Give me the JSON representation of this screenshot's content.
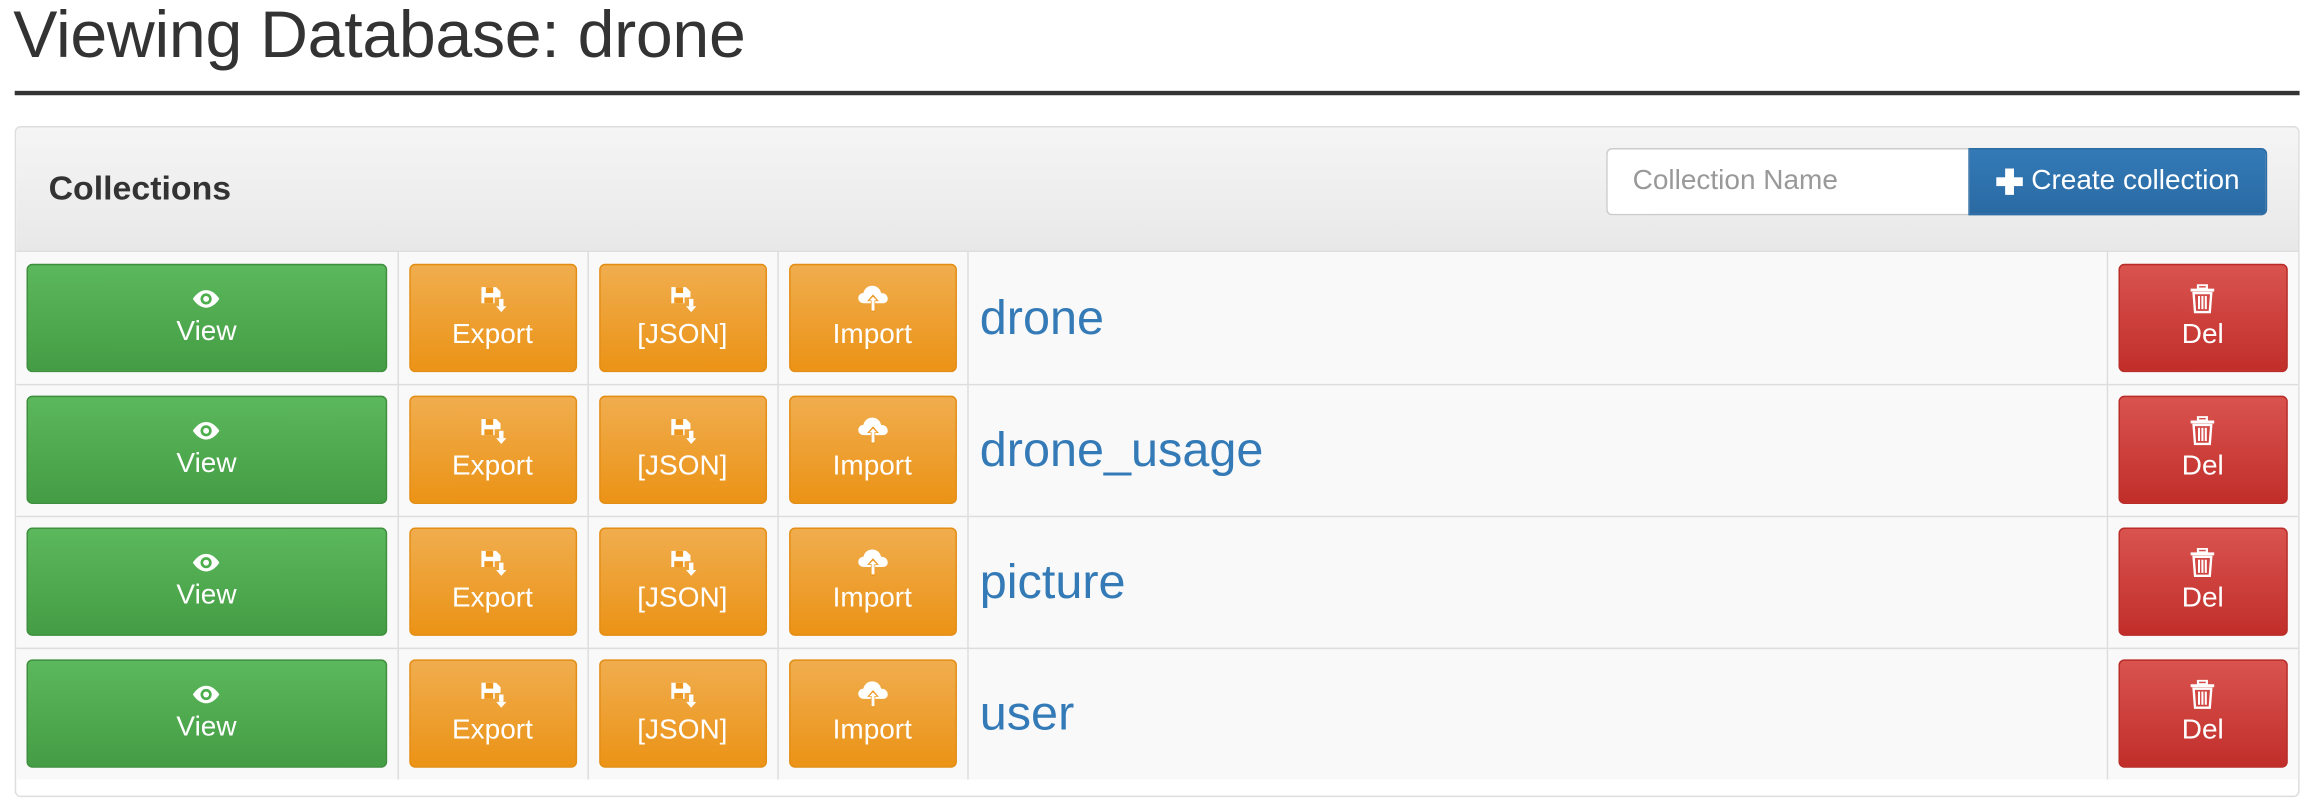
{
  "page": {
    "title": "Viewing Database: drone"
  },
  "panel": {
    "title": "Collections",
    "create": {
      "placeholder": "Collection Name",
      "value": "",
      "button_label": "Create collection",
      "button_icon": "plus-icon"
    }
  },
  "actions": {
    "view": {
      "label": "View",
      "icon": "eye-icon"
    },
    "export": {
      "label": "Export",
      "icon": "save-download-icon"
    },
    "json": {
      "label": "[JSON]",
      "icon": "save-download-icon"
    },
    "import": {
      "label": "Import",
      "icon": "cloud-upload-icon"
    },
    "delete": {
      "label": "Del",
      "icon": "trash-icon"
    }
  },
  "collections": [
    {
      "name": "drone"
    },
    {
      "name": "drone_usage"
    },
    {
      "name": "picture"
    },
    {
      "name": "user"
    }
  ],
  "colors": {
    "view": "#5cb85c",
    "warning": "#f0ad4e",
    "danger": "#d9534f",
    "primary": "#337ab7",
    "link": "#337ab7"
  }
}
